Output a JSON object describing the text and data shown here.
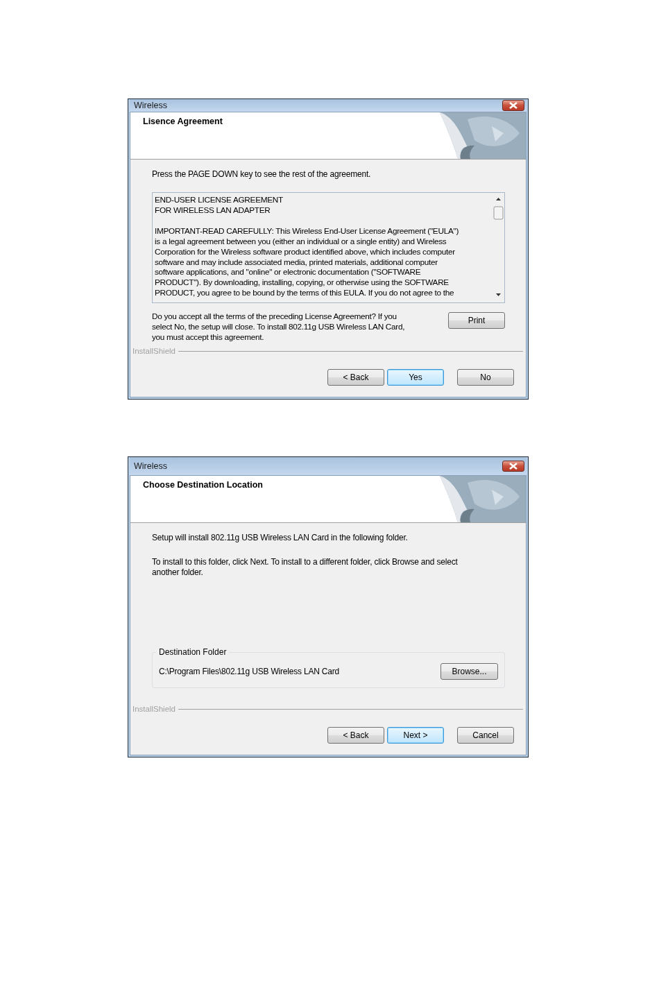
{
  "dialogs": [
    {
      "title": "Wireless",
      "header": "Lisence Agreement",
      "body": [
        {
          "kind": "text",
          "lines": [
            "Press the PAGE DOWN key to see the rest of the agreement."
          ]
        },
        {
          "kind": "license",
          "paragraphs": [
            [
              "END-USER LICENSE AGREEMENT",
              "FOR WIRELESS LAN ADAPTER"
            ],
            [
              "IMPORTANT-READ CAREFULLY: This Wireless End-User License Agreement (\"EULA\")",
              "is a legal agreement between you (either an individual or a single entity) and Wireless",
              "Corporation for the Wireless software product identified above, which includes computer",
              "software and may include associated media, printed materials, additional computer",
              "software applications, and \"online\" or electronic documentation (\"SOFTWARE",
              "PRODUCT\").  By downloading, installing, copying, or otherwise using the SOFTWARE",
              "PRODUCT, you agree to be bound by the terms of this EULA.  If you do not agree to the"
            ]
          ]
        },
        {
          "kind": "prompt",
          "lines": [
            "Do you accept all the terms of the preceding License Agreement?  If you",
            "select No,  the setup will close.  To install 802.11g USB Wireless LAN Card,",
            "you must accept this agreement."
          ],
          "button": "Print"
        }
      ],
      "brand": "InstallShield",
      "buttons": [
        {
          "label": "< Back",
          "default": false
        },
        {
          "label": "Yes",
          "default": true
        },
        {
          "label": "No",
          "default": false
        }
      ]
    },
    {
      "title": "Wireless",
      "header": "Choose Destination Location",
      "body": [
        {
          "kind": "text",
          "lines": [
            "Setup will install 802.11g USB Wireless LAN Card in the following folder."
          ]
        },
        {
          "kind": "text",
          "lines": [
            "To install to this folder, click Next.  To install to a different folder, click Browse and select",
            "another folder."
          ]
        },
        {
          "kind": "folder",
          "legend": "Destination Folder",
          "path": "C:\\Program Files\\802.11g USB Wireless LAN Card",
          "button": "Browse..."
        }
      ],
      "brand": "InstallShield",
      "buttons": [
        {
          "label": "< Back",
          "default": false
        },
        {
          "label": "Next >",
          "default": true
        },
        {
          "label": "Cancel",
          "default": false
        }
      ]
    }
  ]
}
